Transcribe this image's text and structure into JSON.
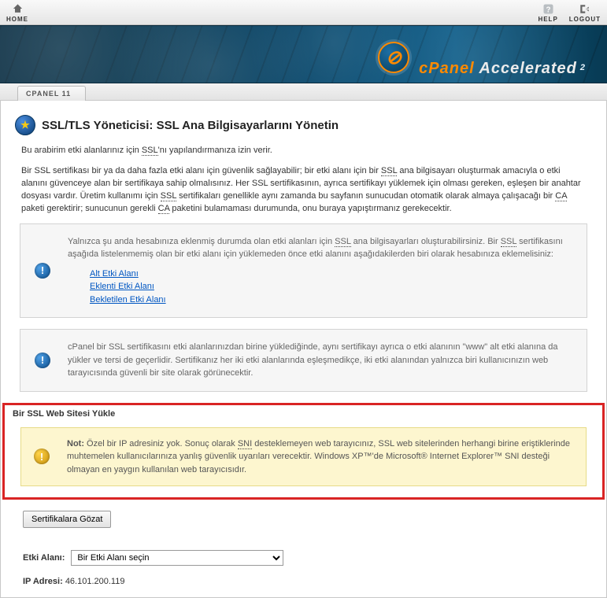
{
  "topbar": {
    "home": "HOME",
    "help": "HELP",
    "logout": "LOGOUT"
  },
  "brand": {
    "name1": "cPanel",
    "name2": "Accelerated",
    "sub": "2"
  },
  "tab": {
    "label": "CPANEL 11"
  },
  "heading": "SSL/TLS Yöneticisi: SSL Ana Bilgisayarlarını Yönetin",
  "intro": {
    "p1a": "Bu arabirim etki alanlarınız için ",
    "p1_ssl": "SSL",
    "p1b": "'nı yapılandırmanıza izin verir.",
    "p2a": "Bir SSL sertifikası bir ya da daha fazla etki alanı için güvenlik sağlayabilir; bir etki alanı için bir ",
    "p2_ssl": "SSL",
    "p2b": " ana bilgisayarı oluşturmak amacıyla o etki alanını güvenceye alan bir sertifikaya sahip olmalısınız. Her SSL sertifikasının, ayrıca sertifikayı yüklemek için olması gereken, eşleşen bir anahtar dosyası vardır. Üretim kullanımı için ",
    "p2_ssl2": "SSL",
    "p2c": " sertifikaları genellikle aynı zamanda bu sayfanın sunucudan otomatik olarak almaya çalışacağı bir ",
    "p2_ca1": "CA",
    "p2d": " paketi gerektirir; sunucunun gerekli ",
    "p2_ca2": "CA",
    "p2e": " paketini bulamaması durumunda, onu buraya yapıştırmanız gerekecektir."
  },
  "info1": {
    "text_a": "Yalnızca şu anda hesabınıza eklenmiş durumda olan etki alanları için ",
    "ssl1": "SSL",
    "text_b": " ana bilgisayarları oluşturabilirsiniz. Bir ",
    "ssl2": "SSL",
    "text_c": " sertifikasını aşağıda listelenmemiş olan bir etki alanı için yüklemeden önce etki alanını aşağıdakilerden biri olarak hesabınıza eklemelisiniz:",
    "links": {
      "sub": "Alt Etki Alanı",
      "addon": "Eklenti Etki Alanı",
      "park": "Bekletilen Etki Alanı"
    }
  },
  "info2": {
    "text": "cPanel bir SSL sertifikasını etki alanlarınızdan birine yüklediğinde, aynı sertifikayı ayrıca o etki alanının \"www\" alt etki alanına da yükler ve tersi de geçerlidir. Sertifikanız her iki etki alanlarında eşleşmedikçe, iki etki alanından yalnızca biri kullanıcınızın web tarayıcısında güvenli bir site olarak görünecektir."
  },
  "section": {
    "title": "Bir SSL Web Sitesi Yükle"
  },
  "warn": {
    "label": "Not:",
    "a": " Özel bir IP adresiniz yok. Sonuç olarak ",
    "sni": "SNI",
    "b": " desteklemeyen web tarayıcınız, SSL web sitelerinden herhangi birine eriştiklerinde muhtemelen kullanıcılarınıza yanlış güvenlik uyarıları verecektir. Windows XP™'de Microsoft® Internet Explorer™ SNI desteği olmayan en yaygın kullanılan web tarayıcısıdır."
  },
  "form": {
    "browse": "Sertifikalara Gözat",
    "domain_label": "Etki Alanı:",
    "domain_placeholder": "Bir Etki Alanı seçin",
    "ip_label": "IP Adresi:",
    "ip_value": "46.101.200.119"
  }
}
